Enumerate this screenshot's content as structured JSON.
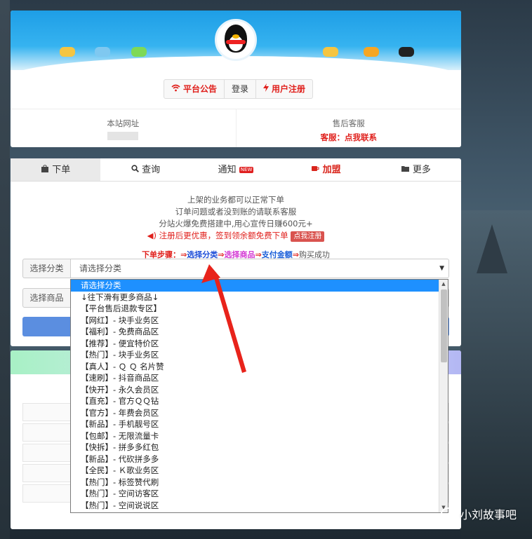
{
  "header": {
    "nav": [
      {
        "label": "平台公告",
        "icon": "wifi-icon",
        "style": "red"
      },
      {
        "label": "登录",
        "icon": "",
        "style": "plain"
      },
      {
        "label": "用户注册",
        "icon": "bolt-icon",
        "style": "red"
      }
    ],
    "site_label": "本站网址",
    "service_label": "售后客服",
    "service_contact": "客服：点我联系"
  },
  "tabs": [
    {
      "label": "下单",
      "icon": "shopping-bag-icon",
      "active": true
    },
    {
      "label": "查询",
      "icon": "search-icon"
    },
    {
      "label": "通知",
      "icon": "",
      "badge": "NEW"
    },
    {
      "label": "加盟",
      "icon": "coffee-icon",
      "red": true
    },
    {
      "label": "更多",
      "icon": "folder-icon"
    }
  ],
  "notice": {
    "line1": "上架的业务都可以正常下单",
    "line2": "订单问题或者没到账的请联系客服",
    "line3": "分站火爆免费搭建中,用心宣传日赚600元+",
    "line4": "注册后更优惠，签到领余额免费下单",
    "line4_button": "点我注册"
  },
  "steps": {
    "label": "下单步骤：",
    "s1": "选择分类",
    "s2": "选择商品",
    "s3": "支付金额",
    "s4": "购买成功"
  },
  "form": {
    "category_label": "选择分类",
    "category_value": "请选择分类",
    "product_label": "选择商品"
  },
  "dropdown": {
    "items": [
      "请选择分类",
      "↓往下滑有更多商品↓",
      "【平台售后退款专区】",
      "【网红】- 块手业务区",
      "【福利】- 免费商品区",
      "【推荐】- 便宜特价区",
      "【热门】- 块手业务区",
      "【真人】- Ｑ Ｑ 名片赞",
      "【速刷】- 抖音商品区",
      "【快开】- 永久会员区",
      "【直充】- 官方ＱＱ钻",
      "【官方】- 年费会员区",
      "【新品】- 手机靓号区",
      "【包邮】- 无限流量卡",
      "【快拆】- 拼多多红包",
      "【新品】- 代砍拼多多",
      "【全民】- Ｋ歌业务区",
      "【热门】- 标签赞代刷",
      "【热门】- 空间访客区",
      "【热门】- 空间说说区"
    ],
    "selected_index": 0
  },
  "watermark": "小刘故事吧",
  "colors": {
    "accent_red": "#e0201c",
    "selected_blue": "#1e90ff",
    "submit_blue": "#5b8ee0"
  }
}
